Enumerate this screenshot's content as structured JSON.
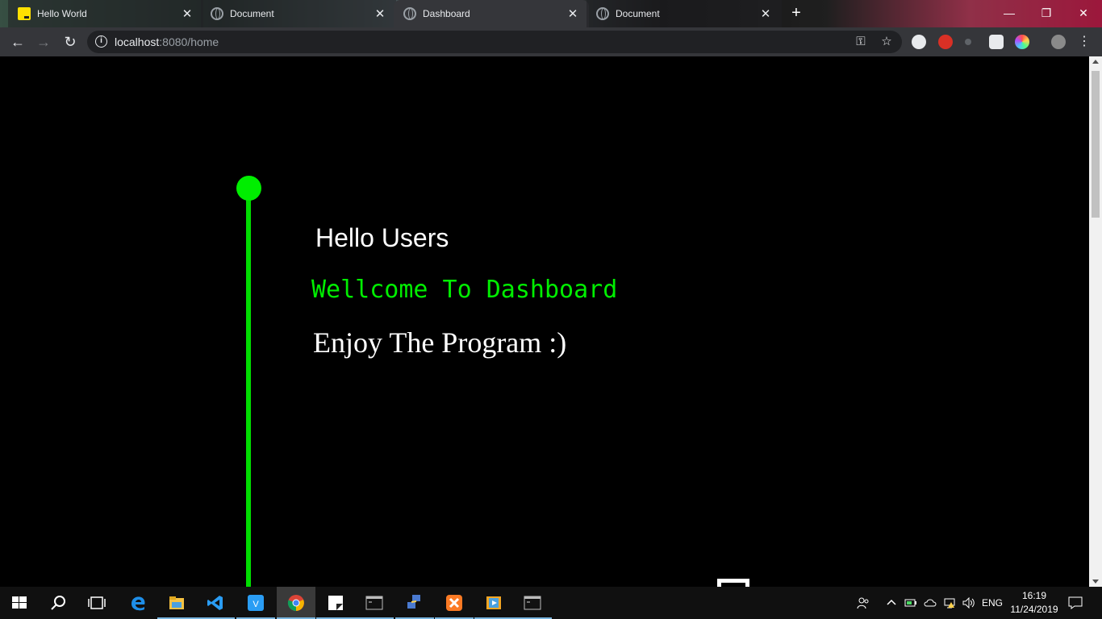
{
  "browser": {
    "tabs": [
      {
        "title": "Hello World",
        "favicon": "yellow-app-icon",
        "active": false
      },
      {
        "title": "Document",
        "favicon": "globe-icon",
        "active": false
      },
      {
        "title": "Dashboard",
        "favicon": "globe-icon",
        "active": true
      },
      {
        "title": "Document",
        "favicon": "globe-icon",
        "active": false
      }
    ],
    "close_glyph": "✕",
    "new_tab_glyph": "+",
    "window_controls": {
      "minimize": "—",
      "restore": "❐",
      "close": "✕"
    },
    "nav": {
      "back": "←",
      "forward": "→",
      "reload": "↻"
    },
    "url_host": "localhost",
    "url_rest": ":8080/home",
    "info_glyph": "i",
    "key_glyph": "⚿",
    "star_glyph": "☆",
    "menu_glyph": "⋮"
  },
  "page": {
    "greeting": "Hello Users",
    "welcome": "Wellcome To Dashboard",
    "tagline": "Enjoy The Program :)",
    "accent_color": "#00ee00"
  },
  "taskbar": {
    "apps": [
      "start",
      "search",
      "task-view",
      "edge",
      "file-explorer",
      "vscode",
      "vscode-insiders",
      "chrome",
      "sticky-notes",
      "terminal",
      "network",
      "xampp",
      "media-player",
      "terminal-2"
    ],
    "language": "ENG",
    "time": "16:19",
    "date": "11/24/2019"
  }
}
